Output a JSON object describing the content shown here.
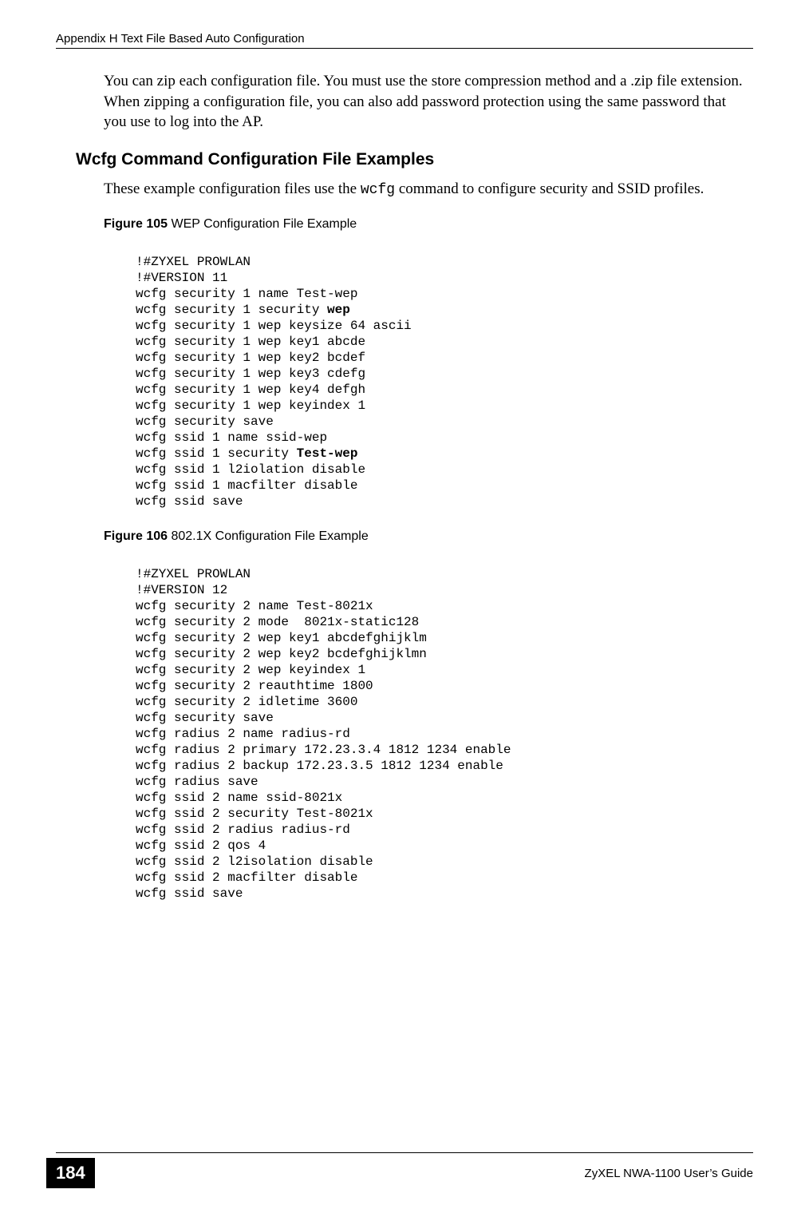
{
  "header": "Appendix H Text File Based Auto Configuration",
  "para1": "You can zip each configuration file. You must use the store compression method and a .zip file extension. When zipping a configuration file, you can also add password protection using the same password that you use to log into the AP.",
  "h2": "Wcfg Command Configuration File Examples",
  "para2_pre": "These example configuration files use the ",
  "para2_code": "wcfg",
  "para2_post": " command to configure security and SSID profiles.",
  "fig105_label_bold": "Figure 105",
  "fig105_label_rest": "   WEP Configuration File Example",
  "code105_l1": "!#ZYXEL PROWLAN",
  "code105_l2": "!#VERSION 11",
  "code105_l3": "wcfg security 1 name Test-wep",
  "code105_l4a": "wcfg security 1 security ",
  "code105_l4b": "wep",
  "code105_l5": "wcfg security 1 wep keysize 64 ascii",
  "code105_l6": "wcfg security 1 wep key1 abcde",
  "code105_l7": "wcfg security 1 wep key2 bcdef",
  "code105_l8": "wcfg security 1 wep key3 cdefg",
  "code105_l9": "wcfg security 1 wep key4 defgh",
  "code105_l10": "wcfg security 1 wep keyindex 1",
  "code105_l11": "wcfg security save",
  "code105_l12": "wcfg ssid 1 name ssid-wep",
  "code105_l13a": "wcfg ssid 1 security ",
  "code105_l13b": "Test-wep",
  "code105_l14": "wcfg ssid 1 l2iolation disable",
  "code105_l15": "wcfg ssid 1 macfilter disable",
  "code105_l16": "wcfg ssid save",
  "fig106_label_bold": "Figure 106",
  "fig106_label_rest": "   802.1X Configuration File Example",
  "code106": "!#ZYXEL PROWLAN\n!#VERSION 12\nwcfg security 2 name Test-8021x\nwcfg security 2 mode  8021x-static128\nwcfg security 2 wep key1 abcdefghijklm\nwcfg security 2 wep key2 bcdefghijklmn\nwcfg security 2 wep keyindex 1\nwcfg security 2 reauthtime 1800\nwcfg security 2 idletime 3600\nwcfg security save\nwcfg radius 2 name radius-rd\nwcfg radius 2 primary 172.23.3.4 1812 1234 enable\nwcfg radius 2 backup 172.23.3.5 1812 1234 enable\nwcfg radius save\nwcfg ssid 2 name ssid-8021x\nwcfg ssid 2 security Test-8021x\nwcfg ssid 2 radius radius-rd\nwcfg ssid 2 qos 4\nwcfg ssid 2 l2isolation disable\nwcfg ssid 2 macfilter disable\nwcfg ssid save",
  "page_num": "184",
  "footer_right": "ZyXEL NWA-1100 User’s Guide"
}
